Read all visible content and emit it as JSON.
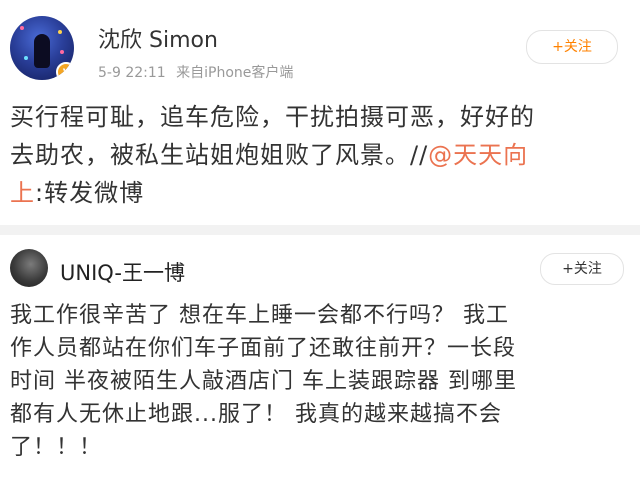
{
  "post1": {
    "author": "沈欣 Simon",
    "date": "5-9 22:11",
    "source": "来自iPhone客户端",
    "follow_label": "+关注",
    "text_lines": [
      "买行程可耻，追车危险，干扰拍摄可恶，好好的",
      "去助农，被私生站姐炮姐败了风景。//"
    ],
    "mention": "@天天向",
    "mention_cont": "上",
    "repost_suffix": ":转发微博"
  },
  "post2": {
    "author": "UNIQ-王一博",
    "follow_label": "+关注",
    "text_lines": [
      "我工作很辛苦了 想在车上睡一会都不行吗？ 我工",
      "作人员都站在你们车子面前了还敢往前开？一长段",
      "时间 半夜被陌生人敲酒店门 车上装跟踪器 到哪里",
      "都有人无休止地跟...服了！ 我真的越来越搞不会",
      "了！！！"
    ]
  },
  "colors": {
    "follow_orange": "#ff8200",
    "mention": "#eb7350",
    "divider": "#f2f2f2",
    "meta_gray": "#999999"
  }
}
